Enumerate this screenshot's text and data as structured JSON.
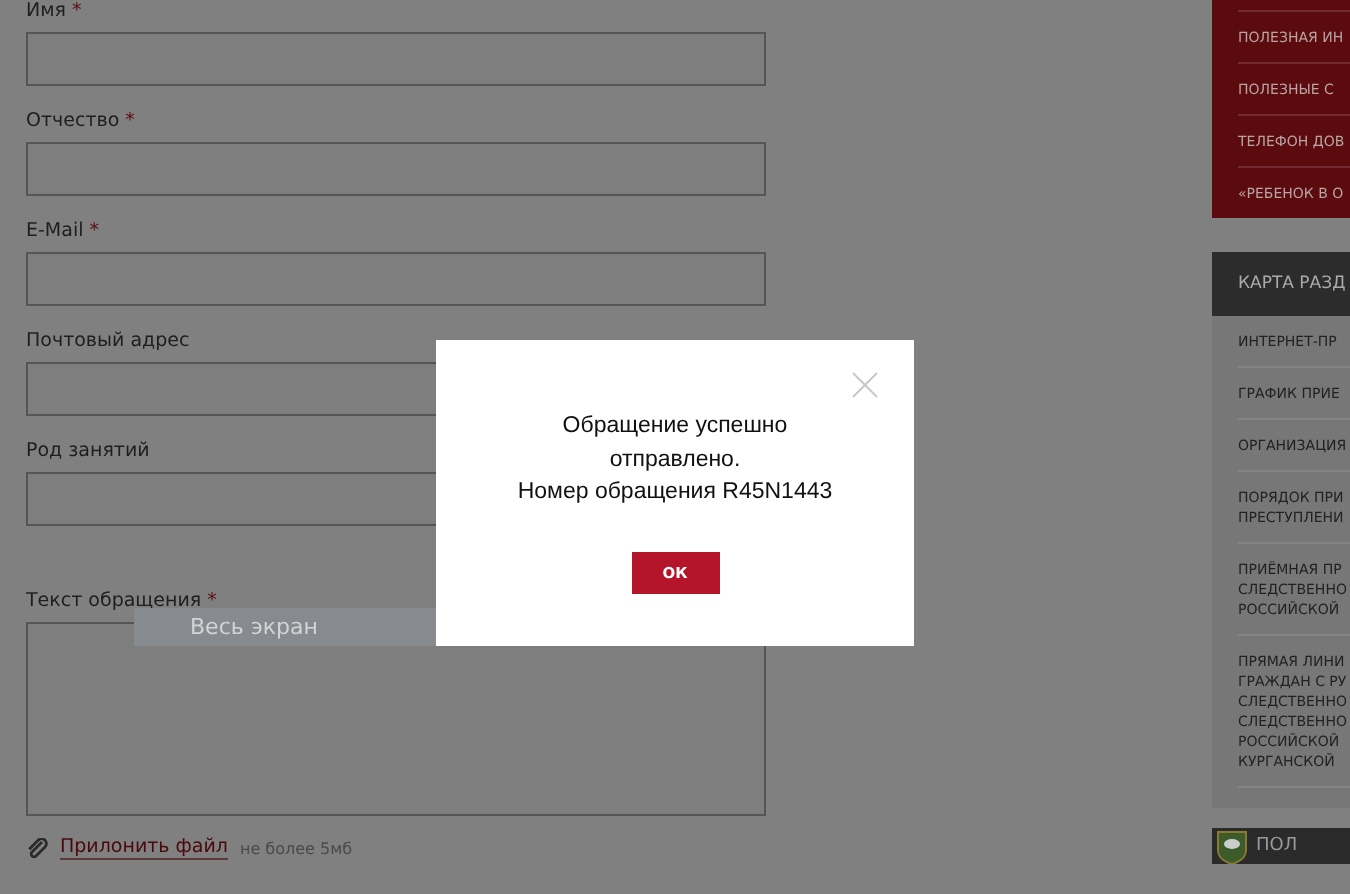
{
  "form": {
    "fields": [
      {
        "label": "Имя",
        "required": true,
        "kind": "input"
      },
      {
        "label": "Отчество",
        "required": true,
        "kind": "input"
      },
      {
        "label": "E-Mail",
        "required": true,
        "kind": "input"
      },
      {
        "label": "Почтовый адрес",
        "required": false,
        "kind": "input"
      },
      {
        "label": "Род занятий",
        "required": false,
        "kind": "input"
      },
      {
        "label": "Текст обращения",
        "required": true,
        "kind": "textarea"
      }
    ],
    "required_mark": "*",
    "attach": {
      "link": "Прилонить файл",
      "hint": "не более 5мб"
    }
  },
  "tooltip": "Весь экран",
  "sidebar": {
    "links": [
      "ПОЛЕЗНАЯ ИН",
      "ПОЛЕЗНЫЕ С",
      "ТЕЛЕФОН ДОВ",
      "«РЕБЕНОК В О"
    ],
    "map_title": "КАРТА РАЗД",
    "map_items": [
      "ИНТЕРНЕТ-ПР",
      "ГРАФИК ПРИЕ",
      "ОРГАНИЗАЦИЯ",
      "ПОРЯДОК ПРИ\nПРЕСТУПЛЕНИ",
      "ПРИЁМНАЯ ПР\nСЛЕДСТВЕННО\nРОССИЙСКОЙ",
      "ПРЯМАЯ ЛИНИ\nГРАЖДАН С РУ\nСЛЕДСТВЕННО\nСЛЕДСТВЕННО\nРОССИЙСКОЙ\nКУРГАНСКОЙ"
    ],
    "banner": "ПОЛ"
  },
  "dialog": {
    "message": "Обращение успешно\nотправлено.\nНомер обращения R45N1443",
    "button": "ОК"
  }
}
